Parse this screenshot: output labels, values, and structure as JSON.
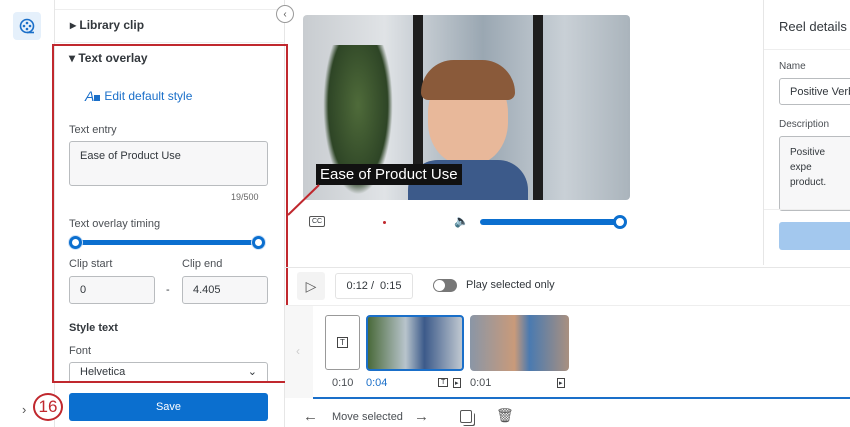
{
  "sidebar": {
    "reel_icon": "film-reel-icon"
  },
  "panel": {
    "library_clip": "Library clip",
    "text_overlay": "Text overlay",
    "edit_default_style": "Edit default style",
    "text_entry_label": "Text entry",
    "text_entry_value": "Ease of Product Use",
    "char_count": "19/500",
    "timing_label": "Text overlay timing",
    "timing_range": [
      0,
      1
    ],
    "clip_start_label": "Clip start",
    "clip_start_value": "0",
    "separator": "-",
    "clip_end_label": "Clip end",
    "clip_end_value": "4.405",
    "style_text": "Style text",
    "font_label": "Font",
    "font_value": "Helvetica",
    "save": "Save"
  },
  "annotation": {
    "step": "16",
    "color": "#c0282e"
  },
  "player": {
    "caption": "Ease of Product Use",
    "cc": "CC",
    "volume": 1,
    "current_time": "0:12 /",
    "total_time": "0:15",
    "play_selected_only": "Play selected only"
  },
  "timeline": {
    "clips": [
      {
        "type": "text",
        "duration": "0:10"
      },
      {
        "type": "video",
        "duration": "0:04",
        "selected": true
      },
      {
        "type": "video",
        "duration": "0:01"
      }
    ],
    "move_selected": "Move selected"
  },
  "reel_details": {
    "title": "Reel details",
    "name_label": "Name",
    "name_value": "Positive Verb",
    "description_label": "Description",
    "description_value": "Positive expe product."
  },
  "colors": {
    "accent": "#0b6fcf",
    "selected_time": "#1a6fc9"
  }
}
